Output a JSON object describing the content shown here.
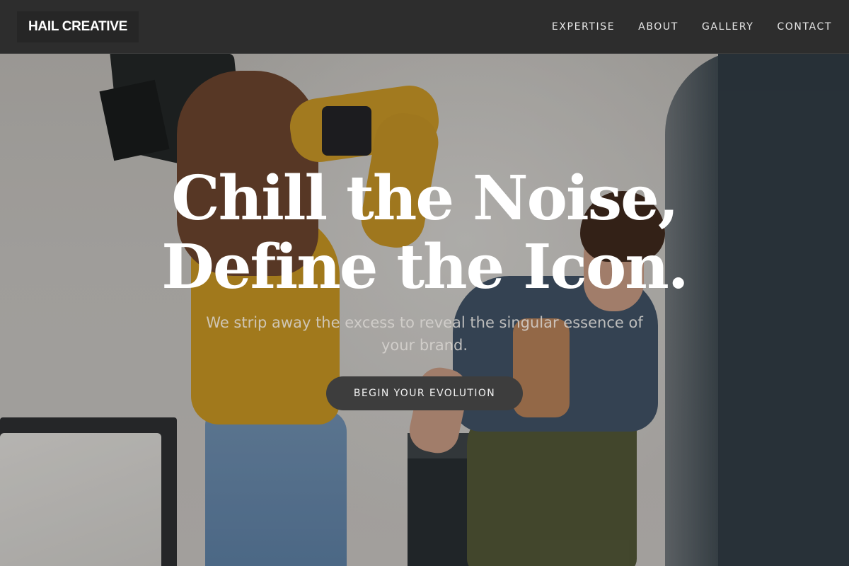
{
  "brand": {
    "logo_text": "HAIL CREATIVE"
  },
  "nav": {
    "items": [
      {
        "label": "EXPERTISE"
      },
      {
        "label": "ABOUT"
      },
      {
        "label": "GALLERY"
      },
      {
        "label": "CONTACT"
      }
    ]
  },
  "hero": {
    "headline_line1": "Chill the Noise,",
    "headline_line2": "Define the Icon.",
    "subtitle": "We strip away the excess to reveal the singular essence of your brand.",
    "cta_label": "BEGIN YOUR EVOLUTION"
  },
  "colors": {
    "navbar_bg": "#2d2d2d",
    "cta_bg": "#3d3d3d",
    "text_light": "#ffffff"
  }
}
